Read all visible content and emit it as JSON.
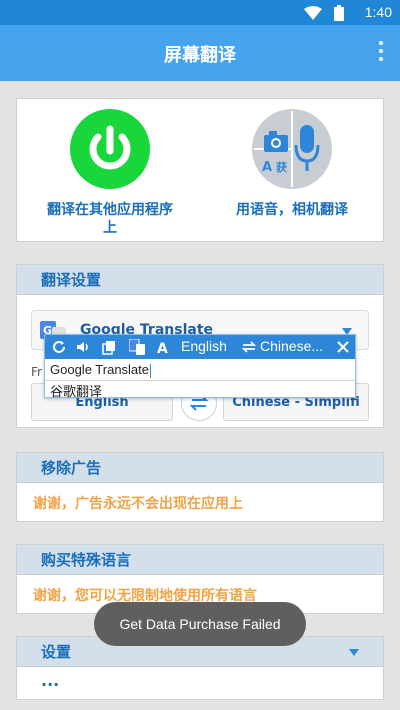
{
  "status_bar": {
    "time": "1:40"
  },
  "app_bar": {
    "title": "屏幕翻译"
  },
  "features": {
    "translate_on_apps": {
      "label_line1": "翻译在其他应用程序",
      "label_line2": "上"
    },
    "voice_camera": {
      "label": "用语音，相机翻译"
    }
  },
  "translate_settings": {
    "header": "翻译设置",
    "engine": "Google Translate",
    "from_label": "Fr",
    "source_lang": "English",
    "target_lang": "Chinese - Simplifi"
  },
  "popup": {
    "source_lang": "English",
    "target_lang": "Chinese...",
    "source_text": "Google Translate",
    "translated_text": "谷歌翻译"
  },
  "remove_ads": {
    "header": "移除广告",
    "body": "谢谢，广告永远不会出现在应用上"
  },
  "buy_languages": {
    "header": "购买特殊语言",
    "body": "谢谢，您可以无限制地使用所有语言"
  },
  "setup": {
    "header": "设置",
    "body": "..."
  },
  "toast": {
    "text": "Get Data Purchase Failed"
  },
  "colors": {
    "app_bar": "#45a4ed",
    "status_bar": "#1f87d6",
    "accent_blue": "#1b6fb8",
    "power_green": "#19d73a",
    "orange": "#f0a347"
  }
}
